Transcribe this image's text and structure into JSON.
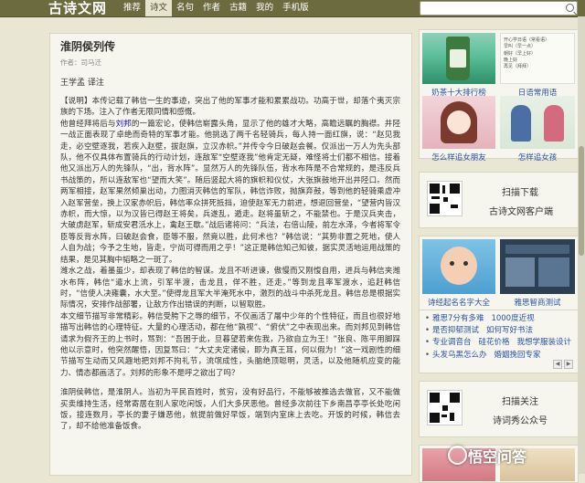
{
  "header": {
    "logo": "古诗文网",
    "nav": [
      "推荐",
      "诗文",
      "名句",
      "作者",
      "古籍",
      "我的",
      "手机版"
    ],
    "active_nav": "诗文",
    "search_value": ""
  },
  "article": {
    "title": "淮阴侯列传",
    "author_line": "作者：司马迁",
    "annotator": "王学孟 译注",
    "paragraphs": [
      {
        "tag": "【说明】",
        "text": "本传记载了韩信一生的事迹，突出了他的军事才能和累累战功。功高于世，却落个夷灭宗族的下场。注入了作者无限同情和感慨。"
      },
      {
        "pre": "他曾经拜将后与",
        "link": "刘邦",
        "post": "的一篇宏论，使韩信崭露头角，显示了他的雄才大略，高瞻远瞩的胸襟。井陉一战正面表现了卓绝而奇特的军事才能。他挑选了两千名轻骑兵，每人持一面红旗，说：“赵见我走，必空壁逐我，若疾入赵壁，拔赵旗，立汉赤帜。”并传令今日破赵会餐。仅派出一万人为先头部队，他不仅具体布置骑兵的行动计划，连敌军“空壁逐我”他肯定无疑，难怪将士们都不相信。接着他又派出万人的先锋队，“出，背水阵”。显然万人的先锋队伍，背水布阵是不合常规的，是违反兵书战策的，所以连敌军也“望而大笑”。随后竖起大将的旗帜和仪仗，大张旗鼓地开出井陉口。然而两军相接，赵军果然倾巢出动，力图消灭韩信的军队，韩信诈败，抛旗弃鼓，等到他的轻骑乘虚冲入赵军营垒，换上汉家赤帜后，韩信率众拼死抵挡，迫使赵军无力前进，想退回营垒，“望营内皆汉赤帜，而大惊，以为汉皆已得赵王将矣，兵遂乱，遁走。赵将虽斩之，不能禁也。于是汉兵夹击，大破虏赵军，斩成安君泜水上，禽赵王歇。”战后诸将问：“兵法，右倍山陵，前左水泽，今者将军令臣等反背水阵，曰破赵会食，臣等不服，然竟以胜，此何术也？”韩信说：“其势非置之死地，使人人自为战；今予之生地，皆走，宁尚可得而用之乎！”这正是韩信知己知彼，据实灵活地运用战策的结果，是见其胸中韬略之一斑了。"
      },
      {
        "text": "潍水之战，着墨虽少，却表现了韩信的智谋。龙且不听进谏，傲慢而又刚愎自用，进兵与韩信夹潍水布阵，韩信“遣水上流，引军半渡，击龙且，佯不胜，还走。”等到龙且率军渡水，追赶韩信时，“信使人决雍囊，水大至。”使得龙且军大半淹死水中，激烈的战斗中杀死龙且。韩信总是根据实际情况，安排作战部署，让敌方作出错误的判断，以智取胜。"
      },
      {
        "text": "本文细节描写非常精彩。韩信受胯下之辱的细节，不仅画活了屠中少年的个性特征，而且也很好地描写出韩信的心理特征。大量的心理活动，都在他“孰视”、“俯伏”之中表现出来。而刘邦见到韩信请求为假齐王的上书时，骂到：“吾困于此，旦暮望若来佐我，乃欲自立为王！”张良、陈平用脚踩他以示意时，他突然醒悟，因复骂曰：“大丈夫定诸侯，即为真王耳，何以假为！”这一戏剧性的细节描写生动而又风趣地把刘邦不拘礼节，流氓成性，头脑绝顶聪明，灵活，以及他随机应变的能力、情态都画活了。刘邦的形象不是呼之欲出了吗？"
      },
      {
        "text": "淮阴侯韩信，是淮阴人。当初为平民百姓时，贫穷，没有好品行，不能够被推选去做官，又不能做买卖维持生活，经常寄居在别人家吃闲饭，人们大多厌恶他。曾经多次前往下乡南昌亭亭长处吃闲饭，接连数月，亭长的妻子嫌恶他，就提前做好早饭，端到内室床上去吃。开饭的时候，韩信去了，却不给他准备饭食。"
      }
    ]
  },
  "sidebar": {
    "tiles_top": [
      {
        "caption": "奶茶十大排行榜"
      },
      {
        "caption": "日语常用语"
      },
      {
        "caption": "怎么样追女朋友"
      },
      {
        "caption": "怎样追女孩"
      }
    ],
    "ad_list_lines": [
      "开心学日语（常看语）",
      "早叫（早一点）",
      "朝好（早上好）",
      "晚上好",
      "再见（拜拜）"
    ],
    "qr1": {
      "title": "扫描下载",
      "subtitle": "古诗文网客户端"
    },
    "tiles_mid": [
      {
        "caption": "诗经起名名字大全"
      },
      {
        "caption": "雅思智商测试"
      }
    ],
    "links": [
      [
        "雅思7分有多难",
        "1000度近视"
      ],
      [
        "是否抑郁测试",
        "如何写好书法"
      ],
      [
        "专业调音台",
        "硅花价格",
        "我想学服装设计"
      ],
      [
        "头发乌黑怎么办",
        "婚姻挽回专家"
      ]
    ],
    "qr2": {
      "title": "扫描关注",
      "subtitle": "诗词秀公众号"
    }
  },
  "watermark": "悟空问答",
  "colors": {
    "nav_bg": "#6c6b40",
    "page_bg": "#e9e6d3",
    "panel_bg": "#f6f6ee",
    "link": "#1a0dab"
  }
}
